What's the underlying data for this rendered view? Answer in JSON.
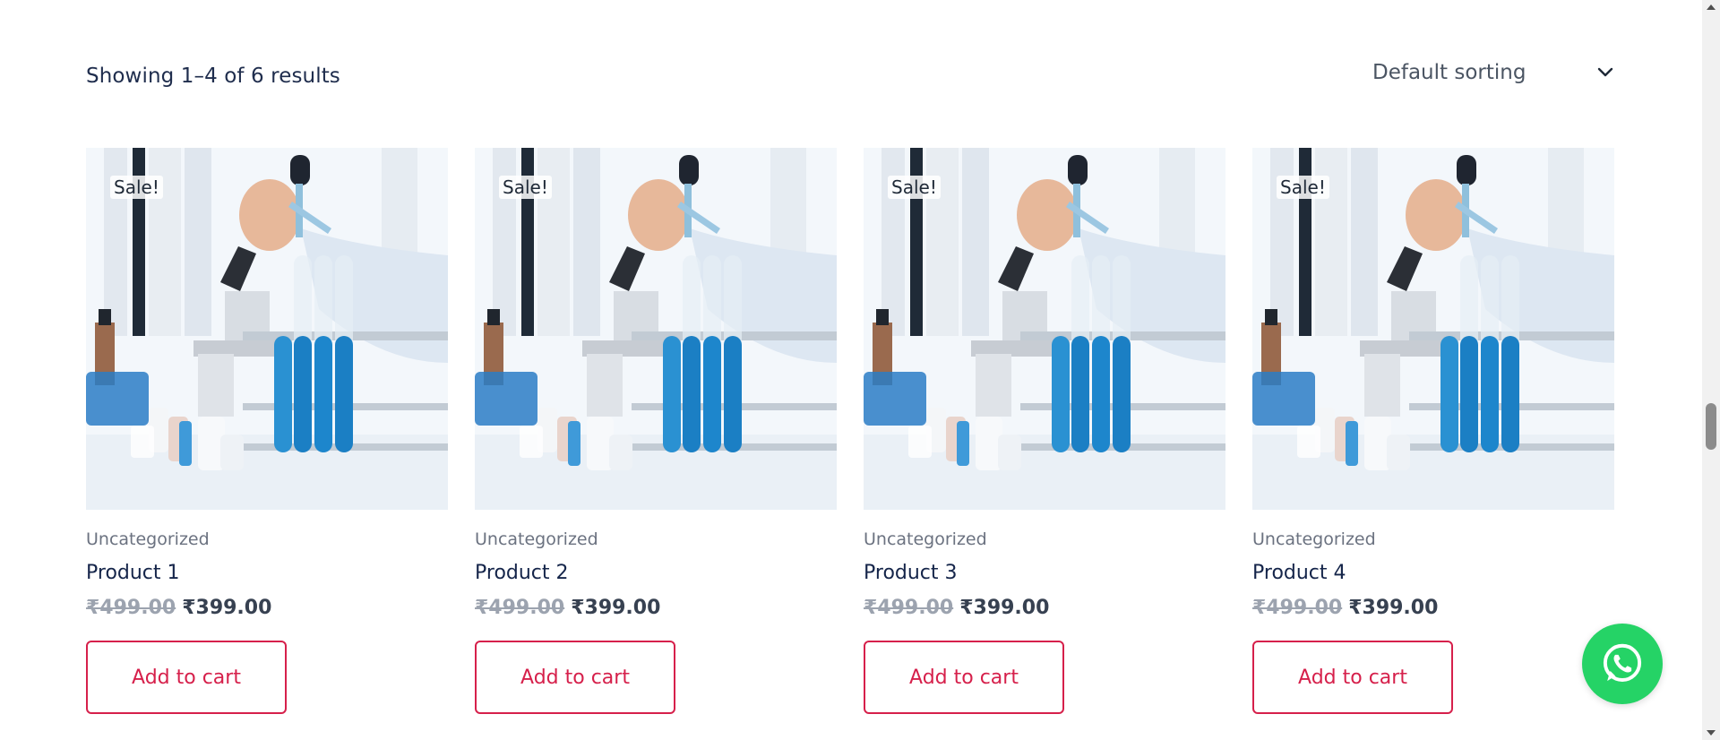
{
  "results": {
    "text": "Showing 1–4 of 6 results"
  },
  "sorting": {
    "selected": "Default sorting",
    "icon": "chevron-down-icon"
  },
  "products": [
    {
      "badge": "Sale!",
      "category": "Uncategorized",
      "title": "Product 1",
      "old_price": "₹499.00",
      "new_price": "₹399.00",
      "button": "Add to cart"
    },
    {
      "badge": "Sale!",
      "category": "Uncategorized",
      "title": "Product 2",
      "old_price": "₹499.00",
      "new_price": "₹399.00",
      "button": "Add to cart"
    },
    {
      "badge": "Sale!",
      "category": "Uncategorized",
      "title": "Product 3",
      "old_price": "₹499.00",
      "new_price": "₹399.00",
      "button": "Add to cart"
    },
    {
      "badge": "Sale!",
      "category": "Uncategorized",
      "title": "Product 4",
      "old_price": "₹499.00",
      "new_price": "₹399.00",
      "button": "Add to cart"
    }
  ],
  "floating": {
    "icon": "whatsapp-icon"
  },
  "colors": {
    "accent": "#d6204b",
    "whatsapp": "#25d366",
    "title": "#15254a"
  }
}
